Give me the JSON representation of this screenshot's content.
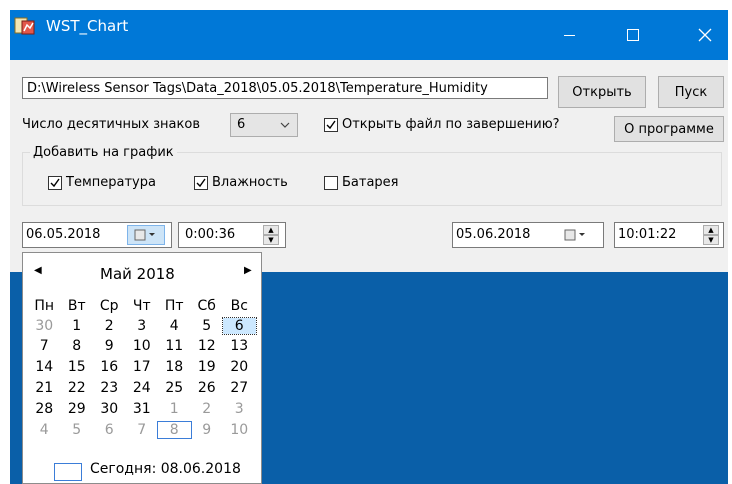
{
  "window": {
    "title": "WST_Chart"
  },
  "file": {
    "path": "D:\\Wireless Sensor Tags\\Data_2018\\05.05.2018\\Temperature_Humidity"
  },
  "buttons": {
    "open": "Открыть",
    "start": "Пуск",
    "about": "О программе"
  },
  "decimals": {
    "label": "Число десятичных знаков",
    "value": "6"
  },
  "open_on_finish": {
    "label": "Открыть файл по завершению?",
    "checked": true
  },
  "add_to_chart": {
    "label": "Добавить на график",
    "items": [
      {
        "label": "Температура",
        "checked": true
      },
      {
        "label": "Влажность",
        "checked": true
      },
      {
        "label": "Батарея",
        "checked": false
      }
    ]
  },
  "start": {
    "date": "06.05.2018",
    "time": "0:00:36"
  },
  "end": {
    "date": "05.06.2018",
    "time": "10:01:22"
  },
  "calendar": {
    "month": "Май 2018",
    "weekdays": [
      "Пн",
      "Вт",
      "Ср",
      "Чт",
      "Пт",
      "Сб",
      "Вс"
    ],
    "weeks": [
      [
        "30",
        "1",
        "2",
        "3",
        "4",
        "5",
        "6"
      ],
      [
        "7",
        "8",
        "9",
        "10",
        "11",
        "12",
        "13"
      ],
      [
        "14",
        "15",
        "16",
        "17",
        "18",
        "19",
        "20"
      ],
      [
        "21",
        "22",
        "23",
        "24",
        "25",
        "26",
        "27"
      ],
      [
        "28",
        "29",
        "30",
        "31",
        "1",
        "2",
        "3"
      ],
      [
        "4",
        "5",
        "6",
        "7",
        "8",
        "9",
        "10"
      ]
    ],
    "today": "Сегодня: 08.06.2018"
  },
  "colors": {
    "titlebar": "#0078d7",
    "background": "#0a5fa8",
    "accent": "#3b7dd8"
  }
}
